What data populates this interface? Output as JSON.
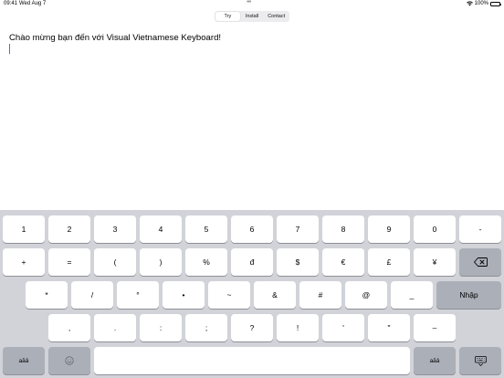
{
  "status_bar": {
    "time": "09:41",
    "date": "Wed Aug 7",
    "battery": "100%",
    "multitask_dots": "•••"
  },
  "segmented": {
    "tabs": [
      {
        "label": "Try",
        "active": true
      },
      {
        "label": "Install",
        "active": false
      },
      {
        "label": "Contact",
        "active": false
      }
    ]
  },
  "editor": {
    "text": "Chào mừng bạn đến với Visual Vietnamese Keyboard!"
  },
  "keyboard": {
    "row1": [
      "1",
      "2",
      "3",
      "4",
      "5",
      "6",
      "7",
      "8",
      "9",
      "0",
      "-"
    ],
    "row1_delete_icon": "backspace-icon",
    "row2": [
      "+",
      "=",
      "(",
      ")",
      "%",
      "đ",
      "$",
      "€",
      "£",
      "¥"
    ],
    "row3": [
      "*",
      "/",
      "°",
      "•",
      "~",
      "&",
      "#",
      "@",
      "_"
    ],
    "row3_return": "Nhập",
    "row4": [
      ",",
      ".",
      ":",
      ";",
      "?",
      "!",
      "'",
      "\"",
      "–"
    ],
    "left_mode": "aăâ",
    "right_mode": "aăâ",
    "emoji_icon": "emoji-icon",
    "dismiss_icon": "keyboard-dismiss-icon",
    "colors": {
      "background": "#d1d3d9",
      "key": "#ffffff",
      "special_key": "#abafb8",
      "caret": "#3478f6"
    }
  }
}
